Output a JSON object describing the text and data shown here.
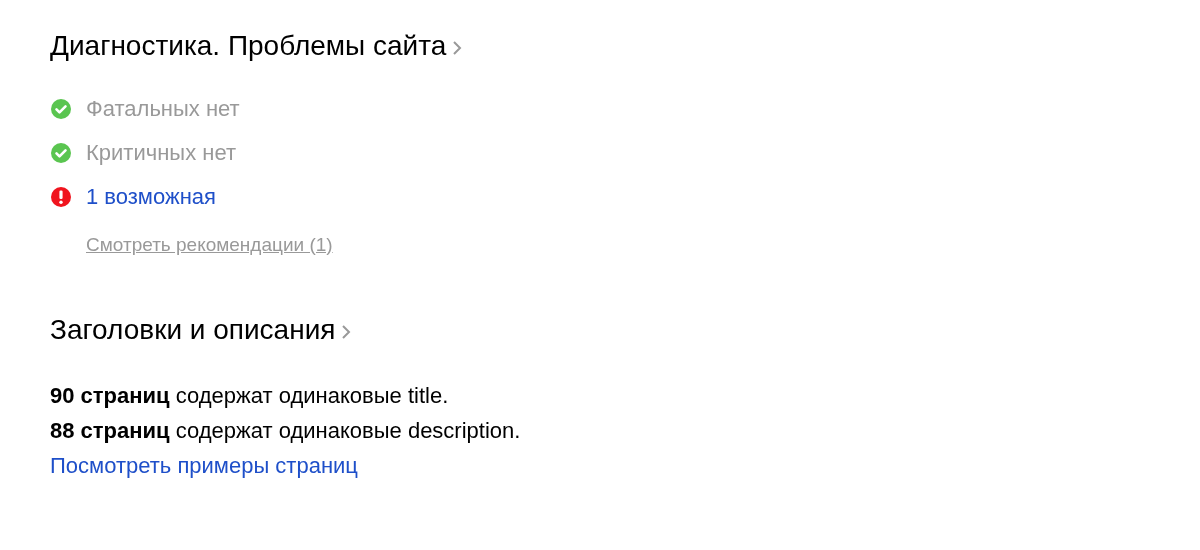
{
  "sections": [
    {
      "title": "Диагностика. Проблемы сайта",
      "status_items": [
        {
          "kind": "ok",
          "text": "Фатальных нет"
        },
        {
          "kind": "ok",
          "text": "Критичных нет"
        },
        {
          "kind": "warning",
          "text": "1 возможная"
        }
      ],
      "recommendations_link": "Смотреть рекомендации (1)"
    },
    {
      "title": "Заголовки и описания",
      "lines": [
        "**90 страниц** содержат одинаковые title.",
        "**88 страниц** содержат одинаковые description."
      ],
      "link": "Посмотреть примеры страниц"
    }
  ]
}
